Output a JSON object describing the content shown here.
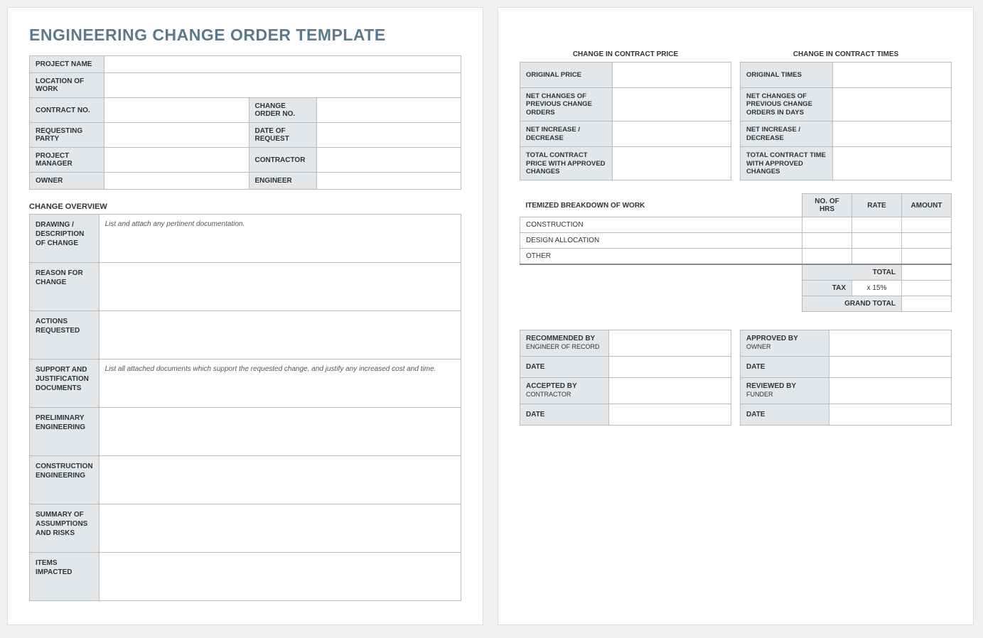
{
  "title": "ENGINEERING CHANGE ORDER TEMPLATE",
  "info_rows": {
    "project_name": "PROJECT NAME",
    "location": "LOCATION OF WORK",
    "contract_no": "CONTRACT NO.",
    "change_order_no": "CHANGE ORDER NO.",
    "requesting_party": "REQUESTING PARTY",
    "date_of_request": "DATE OF REQUEST",
    "project_manager": "PROJECT MANAGER",
    "contractor": "CONTRACTOR",
    "owner": "OWNER",
    "engineer": "ENGINEER"
  },
  "overview_title": "CHANGE OVERVIEW",
  "overview": [
    {
      "label": "DRAWING / DESCRIPTION OF CHANGE",
      "content": "List and attach any pertinent documentation."
    },
    {
      "label": "REASON FOR CHANGE",
      "content": ""
    },
    {
      "label": "ACTIONS REQUESTED",
      "content": ""
    },
    {
      "label": "SUPPORT AND JUSTIFICATION DOCUMENTS",
      "content": "List all attached documents which support the requested change, and justify any increased cost and time."
    },
    {
      "label": "PRELIMINARY ENGINEERING",
      "content": ""
    },
    {
      "label": "CONSTRUCTION ENGINEERING",
      "content": ""
    },
    {
      "label": "SUMMARY OF ASSUMPTIONS AND RISKS",
      "content": ""
    },
    {
      "label": "ITEMS IMPACTED",
      "content": ""
    }
  ],
  "price": {
    "title": "CHANGE IN CONTRACT PRICE",
    "rows": [
      "ORIGINAL PRICE",
      "NET CHANGES OF PREVIOUS CHANGE ORDERS",
      "NET INCREASE / DECREASE",
      "TOTAL CONTRACT PRICE WITH APPROVED CHANGES"
    ]
  },
  "times": {
    "title": "CHANGE IN CONTRACT TIMES",
    "rows": [
      "ORIGINAL TIMES",
      "NET CHANGES OF PREVIOUS CHANGE ORDERS IN DAYS",
      "NET INCREASE / DECREASE",
      "TOTAL CONTRACT TIME WITH APPROVED CHANGES"
    ]
  },
  "itemized": {
    "title": "ITEMIZED BREAKDOWN OF WORK",
    "headers": {
      "hrs": "NO. OF HRS",
      "rate": "RATE",
      "amount": "AMOUNT"
    },
    "rows": [
      "CONSTRUCTION",
      "DESIGN ALLOCATION",
      "OTHER"
    ],
    "total": "TOTAL",
    "tax": "TAX",
    "tax_rate": "x 15%",
    "grand_total": "GRAND TOTAL"
  },
  "approvals": {
    "left": [
      {
        "label": "RECOMMENDED BY",
        "sub": "ENGINEER OF RECORD"
      },
      {
        "label": "DATE",
        "sub": ""
      },
      {
        "label": "ACCEPTED BY",
        "sub": "CONTRACTOR"
      },
      {
        "label": "DATE",
        "sub": ""
      }
    ],
    "right": [
      {
        "label": "APPROVED BY",
        "sub": "OWNER"
      },
      {
        "label": "DATE",
        "sub": ""
      },
      {
        "label": "REVIEWED BY",
        "sub": "FUNDER"
      },
      {
        "label": "DATE",
        "sub": ""
      }
    ]
  }
}
